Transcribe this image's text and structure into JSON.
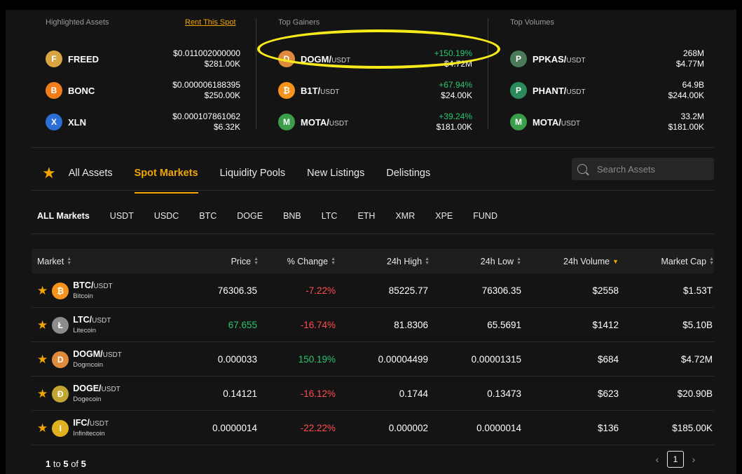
{
  "highlighted": {
    "title": "Highlighted Assets",
    "rent_link": "Rent This Spot",
    "items": [
      {
        "name": "FREED",
        "quote": "",
        "line1": "$0.011002000000",
        "line2": "$281.00K",
        "icon_color": "#d9a441",
        "glyph": "F"
      },
      {
        "name": "BONC",
        "quote": "",
        "line1": "$0.000006188395",
        "line2": "$250.00K",
        "icon_color": "#f07d1a",
        "glyph": "B"
      },
      {
        "name": "XLN",
        "quote": "",
        "line1": "$0.000107861062",
        "line2": "$6.32K",
        "icon_color": "#2b6fd6",
        "glyph": "X"
      }
    ]
  },
  "gainers": {
    "title": "Top Gainers",
    "items": [
      {
        "name": "DOGM/",
        "quote": "USDT",
        "line1": "+150.19%",
        "line2": "$4.72M",
        "icon_color": "#e08a3c",
        "glyph": "D"
      },
      {
        "name": "B1T/",
        "quote": "USDT",
        "line1": "+67.94%",
        "line2": "$24.00K",
        "icon_color": "#f7931a",
        "glyph": "₿"
      },
      {
        "name": "MOTA/",
        "quote": "USDT",
        "line1": "+39.24%",
        "line2": "$181.00K",
        "icon_color": "#3a9e4a",
        "glyph": "M"
      }
    ]
  },
  "volumes": {
    "title": "Top Volumes",
    "items": [
      {
        "name": "PPKAS/",
        "quote": "USDT",
        "line1": "268M",
        "line2": "$4.77M",
        "icon_color": "#4a7a5a",
        "glyph": "P"
      },
      {
        "name": "PHANT/",
        "quote": "USDT",
        "line1": "64.9B",
        "line2": "$244.00K",
        "icon_color": "#2a8a5a",
        "glyph": "P"
      },
      {
        "name": "MOTA/",
        "quote": "USDT",
        "line1": "33.2M",
        "line2": "$181.00K",
        "icon_color": "#3a9e4a",
        "glyph": "M"
      }
    ]
  },
  "tabs": [
    "All Assets",
    "Spot Markets",
    "Liquidity Pools",
    "New Listings",
    "Delistings"
  ],
  "search": {
    "placeholder": "Search Assets"
  },
  "subtabs": [
    "ALL Markets",
    "USDT",
    "USDC",
    "BTC",
    "DOGE",
    "BNB",
    "LTC",
    "ETH",
    "XMR",
    "XPE",
    "FUND"
  ],
  "table": {
    "headers": [
      "Market",
      "Price",
      "% Change",
      "24h High",
      "24h Low",
      "24h Volume",
      "Market Cap"
    ],
    "rows": [
      {
        "pair": "BTC/",
        "quote": "USDT",
        "full": "Bitcoin",
        "price": "76306.35",
        "price_color": "#ffffff",
        "change": "-7.22%",
        "change_color": "#ff4d4f",
        "high": "85225.77",
        "low": "76306.35",
        "volume": "$2558",
        "cap": "$1.53T",
        "icon_color": "#f7931a",
        "glyph": "₿"
      },
      {
        "pair": "LTC/",
        "quote": "USDT",
        "full": "Litecoin",
        "price": "67.655",
        "price_color": "#28c76f",
        "change": "-16.74%",
        "change_color": "#ff4d4f",
        "high": "81.8306",
        "low": "65.5691",
        "volume": "$1412",
        "cap": "$5.10B",
        "icon_color": "#8c8c8c",
        "glyph": "Ł"
      },
      {
        "pair": "DOGM/",
        "quote": "USDT",
        "full": "Dogmcoin",
        "price": "0.000033",
        "price_color": "#ffffff",
        "change": "150.19%",
        "change_color": "#28c76f",
        "high": "0.00004499",
        "low": "0.00001315",
        "volume": "$684",
        "cap": "$4.72M",
        "icon_color": "#e08a3c",
        "glyph": "D"
      },
      {
        "pair": "DOGE/",
        "quote": "USDT",
        "full": "Dogecoin",
        "price": "0.14121",
        "price_color": "#ffffff",
        "change": "-16.12%",
        "change_color": "#ff4d4f",
        "high": "0.1744",
        "low": "0.13473",
        "volume": "$623",
        "cap": "$20.90B",
        "icon_color": "#c2a633",
        "glyph": "Ð"
      },
      {
        "pair": "IFC/",
        "quote": "USDT",
        "full": "Infinitecoin",
        "price": "0.0000014",
        "price_color": "#ffffff",
        "change": "-22.22%",
        "change_color": "#ff4d4f",
        "high": "0.000002",
        "low": "0.0000014",
        "volume": "$136",
        "cap": "$185.00K",
        "icon_color": "#e0b020",
        "glyph": "I"
      }
    ]
  },
  "pagination": {
    "from": "1",
    "to_word": "to",
    "to": "5",
    "of_word": "of",
    "total": "5",
    "current": "1"
  }
}
